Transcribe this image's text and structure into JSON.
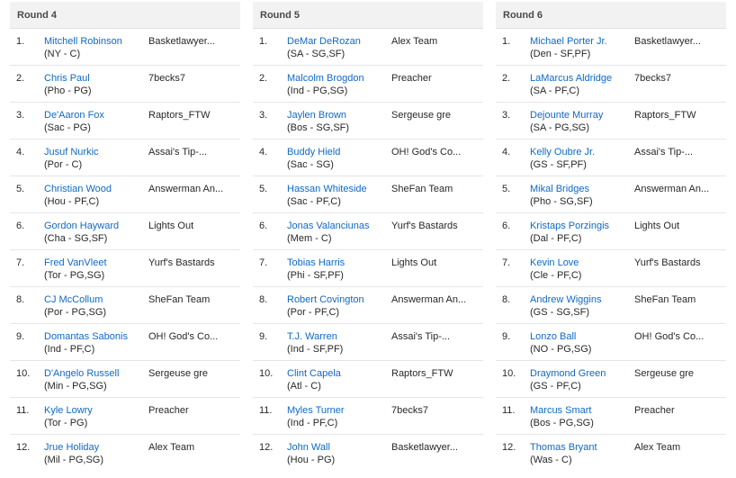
{
  "rounds": [
    {
      "title": "Round 4",
      "picks": [
        {
          "num": "1.",
          "player": "Mitchell Robinson",
          "info": "(NY - C)",
          "team": "Basketlawyer..."
        },
        {
          "num": "2.",
          "player": "Chris Paul",
          "info": "(Pho - PG)",
          "team": "7becks7"
        },
        {
          "num": "3.",
          "player": "De'Aaron Fox",
          "info": "(Sac - PG)",
          "team": "Raptors_FTW"
        },
        {
          "num": "4.",
          "player": "Jusuf Nurkic",
          "info": "(Por - C)",
          "team": "Assai's Tip-..."
        },
        {
          "num": "5.",
          "player": "Christian Wood",
          "info": "(Hou - PF,C)",
          "team": "Answerman An..."
        },
        {
          "num": "6.",
          "player": "Gordon Hayward",
          "info": "(Cha - SG,SF)",
          "team": "Lights Out"
        },
        {
          "num": "7.",
          "player": "Fred VanVleet",
          "info": "(Tor - PG,SG)",
          "team": "Yurf's Bastards"
        },
        {
          "num": "8.",
          "player": "CJ McCollum",
          "info": "(Por - PG,SG)",
          "team": "SheFan Team"
        },
        {
          "num": "9.",
          "player": "Domantas Sabonis",
          "info": "(Ind - PF,C)",
          "team": "OH! God's Co..."
        },
        {
          "num": "10.",
          "player": "D'Angelo Russell",
          "info": "(Min - PG,SG)",
          "team": "Sergeuse gre"
        },
        {
          "num": "11.",
          "player": "Kyle Lowry",
          "info": "(Tor - PG)",
          "team": "Preacher"
        },
        {
          "num": "12.",
          "player": "Jrue Holiday",
          "info": "(Mil - PG,SG)",
          "team": "Alex Team"
        }
      ]
    },
    {
      "title": "Round 5",
      "picks": [
        {
          "num": "1.",
          "player": "DeMar DeRozan",
          "info": "(SA - SG,SF)",
          "team": "Alex Team"
        },
        {
          "num": "2.",
          "player": "Malcolm Brogdon",
          "info": "(Ind - PG,SG)",
          "team": "Preacher"
        },
        {
          "num": "3.",
          "player": "Jaylen Brown",
          "info": "(Bos - SG,SF)",
          "team": "Sergeuse gre"
        },
        {
          "num": "4.",
          "player": "Buddy Hield",
          "info": "(Sac - SG)",
          "team": "OH! God's Co..."
        },
        {
          "num": "5.",
          "player": "Hassan Whiteside",
          "info": "(Sac - PF,C)",
          "team": "SheFan Team"
        },
        {
          "num": "6.",
          "player": "Jonas Valanciunas",
          "info": "(Mem - C)",
          "team": "Yurf's Bastards"
        },
        {
          "num": "7.",
          "player": "Tobias Harris",
          "info": "(Phi - SF,PF)",
          "team": "Lights Out"
        },
        {
          "num": "8.",
          "player": "Robert Covington",
          "info": "(Por - PF,C)",
          "team": "Answerman An..."
        },
        {
          "num": "9.",
          "player": "T.J. Warren",
          "info": "(Ind - SF,PF)",
          "team": "Assai's Tip-..."
        },
        {
          "num": "10.",
          "player": "Clint Capela",
          "info": "(Atl - C)",
          "team": "Raptors_FTW"
        },
        {
          "num": "11.",
          "player": "Myles Turner",
          "info": "(Ind - PF,C)",
          "team": "7becks7"
        },
        {
          "num": "12.",
          "player": "John Wall",
          "info": "(Hou - PG)",
          "team": "Basketlawyer..."
        }
      ]
    },
    {
      "title": "Round 6",
      "picks": [
        {
          "num": "1.",
          "player": "Michael Porter Jr.",
          "info": "(Den - SF,PF)",
          "team": "Basketlawyer..."
        },
        {
          "num": "2.",
          "player": "LaMarcus Aldridge",
          "info": "(SA - PF,C)",
          "team": "7becks7"
        },
        {
          "num": "3.",
          "player": "Dejounte Murray",
          "info": "(SA - PG,SG)",
          "team": "Raptors_FTW"
        },
        {
          "num": "4.",
          "player": "Kelly Oubre Jr.",
          "info": "(GS - SF,PF)",
          "team": "Assai's Tip-..."
        },
        {
          "num": "5.",
          "player": "Mikal Bridges",
          "info": "(Pho - SG,SF)",
          "team": "Answerman An..."
        },
        {
          "num": "6.",
          "player": "Kristaps Porzingis",
          "info": "(Dal - PF,C)",
          "team": "Lights Out"
        },
        {
          "num": "7.",
          "player": "Kevin Love",
          "info": "(Cle - PF,C)",
          "team": "Yurf's Bastards"
        },
        {
          "num": "8.",
          "player": "Andrew Wiggins",
          "info": "(GS - SG,SF)",
          "team": "SheFan Team"
        },
        {
          "num": "9.",
          "player": "Lonzo Ball",
          "info": "(NO - PG,SG)",
          "team": "OH! God's Co..."
        },
        {
          "num": "10.",
          "player": "Draymond Green",
          "info": "(GS - PF,C)",
          "team": "Sergeuse gre"
        },
        {
          "num": "11.",
          "player": "Marcus Smart",
          "info": "(Bos - PG,SG)",
          "team": "Preacher"
        },
        {
          "num": "12.",
          "player": "Thomas Bryant",
          "info": "(Was - C)",
          "team": "Alex Team"
        }
      ]
    }
  ],
  "colors": {
    "link": "#0f69c7",
    "header_bg": "#f2f2f2",
    "text": "#26282a"
  }
}
